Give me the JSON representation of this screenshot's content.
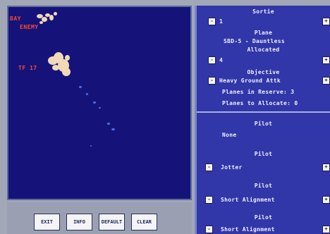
{
  "map": {
    "labels": {
      "bay": "BAY",
      "enemy": "ENEMY",
      "tf": "TF 17"
    }
  },
  "bottom_bar": {
    "buttons": [
      "EXIT",
      "INFO",
      "DEFAULT",
      "CLEAR"
    ]
  },
  "panel": {
    "sortie_header": "Sortie",
    "sortie_value": "1",
    "plane_header": "Plane",
    "plane_line1": "SBD-5 - Dauntless",
    "plane_line2": "Allocated",
    "allocated_value": "4",
    "objective_header": "Objective",
    "objective_value": "Heavy Ground Attk",
    "reserve_line": "Planes in Reserve: 3",
    "allocated_line": "Planes to Allocate: 0",
    "pilots": [
      {
        "header": "Pilot",
        "name": "None"
      },
      {
        "header": "Pilot",
        "name": "Jotter"
      },
      {
        "header": "Pilot",
        "name": "Short Alignment"
      },
      {
        "header": "Pilot",
        "name": "Short Alignment"
      }
    ],
    "dec_glyph": "-",
    "inc_glyph": "+"
  },
  "colors": {
    "map_sea": "#15137a",
    "panel_bg": "#3136a8",
    "label_red": "#ff4a2a",
    "land": "#f2d9b6"
  }
}
